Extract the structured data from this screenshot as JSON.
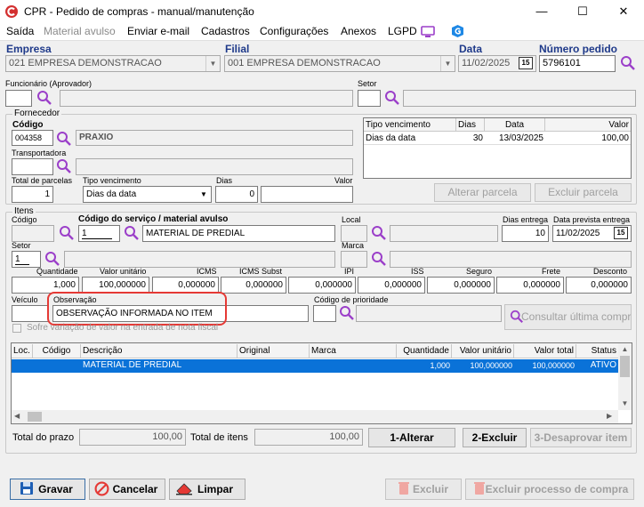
{
  "window": {
    "title": "CPR - Pedido de compras - manual/manutenção",
    "minimize": "—",
    "maximize": "☐",
    "close": "✕"
  },
  "menu": {
    "items": [
      "Saída",
      "Material avulso",
      "Enviar e-mail",
      "Cadastros",
      "Configurações",
      "Anexos",
      "LGPD"
    ]
  },
  "header": {
    "empresa_label": "Empresa",
    "empresa_value": "021 EMPRESA DEMONSTRACAO",
    "filial_label": "Filial",
    "filial_value": "001 EMPRESA DEMONSTRACAO",
    "data_label": "Data",
    "data_value": "11/02/2025",
    "numero_label": "Número pedido",
    "numero_value": "5796101",
    "funcionario_label": "Funcionário (Aprovador)",
    "setor_label": "Setor",
    "calendar_glyph": "15"
  },
  "fornecedor": {
    "group_label": "Fornecedor",
    "codigo_label": "Código",
    "codigo_value": "004358",
    "nome_value": "PRAXIO",
    "transportadora_label": "Transportadora",
    "parcelas_label": "Total de parcelas",
    "parcelas_value": "1",
    "tipo_label": "Tipo vencimento",
    "tipo_value": "Dias da data",
    "dias_label": "Dias",
    "dias_value": "0",
    "valor_label": "Valor",
    "table": {
      "headers": [
        "Tipo vencimento",
        "Dias",
        "Data",
        "Valor"
      ],
      "rows": [
        [
          "Dias da data",
          "30",
          "13/03/2025",
          "100,00"
        ]
      ]
    },
    "alterar_btn": "Alterar parcela",
    "excluir_btn": "Excluir parcela"
  },
  "itens": {
    "group_label": "Itens",
    "codigo_label": "Código",
    "servico_label": "Código do serviço / material avulso",
    "servico_code": "1",
    "servico_desc": "MATERIAL DE PREDIAL",
    "local_label": "Local",
    "dias_entrega_label": "Dias entrega",
    "dias_entrega_value": "10",
    "data_prevista_label": "Data prevista entrega",
    "data_prevista_value": "11/02/2025",
    "setor_label": "Setor",
    "setor_value": "1",
    "marca_label": "Marca",
    "quantidade_label": "Quantidade",
    "quantidade_value": "1,000",
    "valor_unit_label": "Valor unitário",
    "valor_unit_value": "100,000000",
    "icms_label": "ICMS",
    "icms_value": "0,000000",
    "icms_subst_label": "ICMS Subst",
    "icms_subst_value": "0,000000",
    "ipi_label": "IPI",
    "ipi_value": "0,000000",
    "iss_label": "ISS",
    "iss_value": "0,000000",
    "seguro_label": "Seguro",
    "seguro_value": "0,000000",
    "frete_label": "Frete",
    "frete_value": "0,000000",
    "desconto_label": "Desconto",
    "desconto_value": "0,000000",
    "veiculo_label": "Veículo",
    "observacao_label": "Observação",
    "observacao_value": "OBSERVAÇÃO INFORMADA NO ITEM",
    "prioridade_label": "Código de prioridade",
    "consultar_btn": "Consultar última compra",
    "checkbox_label": "Sofre variação de valor na entrada de nota fiscal"
  },
  "grid": {
    "headers": [
      "Loc.",
      "Código",
      "Descrição",
      "Original",
      "Marca",
      "Quantidade",
      "Valor unitário",
      "Valor total",
      "Status"
    ],
    "rows": [
      [
        "",
        "",
        "MATERIAL DE PREDIAL",
        "",
        "",
        "1,000",
        "100,000000",
        "100,000000",
        "ATIVO"
      ]
    ]
  },
  "totals": {
    "prazo_label": "Total do prazo",
    "prazo_value": "100,00",
    "itens_label": "Total de itens",
    "itens_value": "100,00",
    "alterar_btn": "1-Alterar",
    "excluir_btn": "2-Excluir",
    "desaprovar_btn": "3-Desaprovar item"
  },
  "footer": {
    "gravar": "Gravar",
    "cancelar": "Cancelar",
    "limpar": "Limpar",
    "excluir": "Excluir",
    "excluir_processo": "Excluir processo de compra"
  },
  "colors": {
    "accent": "#1f3a8a",
    "highlight": "#e53935",
    "selection": "#0a72d8",
    "magnifier": "#9b3fc9"
  }
}
